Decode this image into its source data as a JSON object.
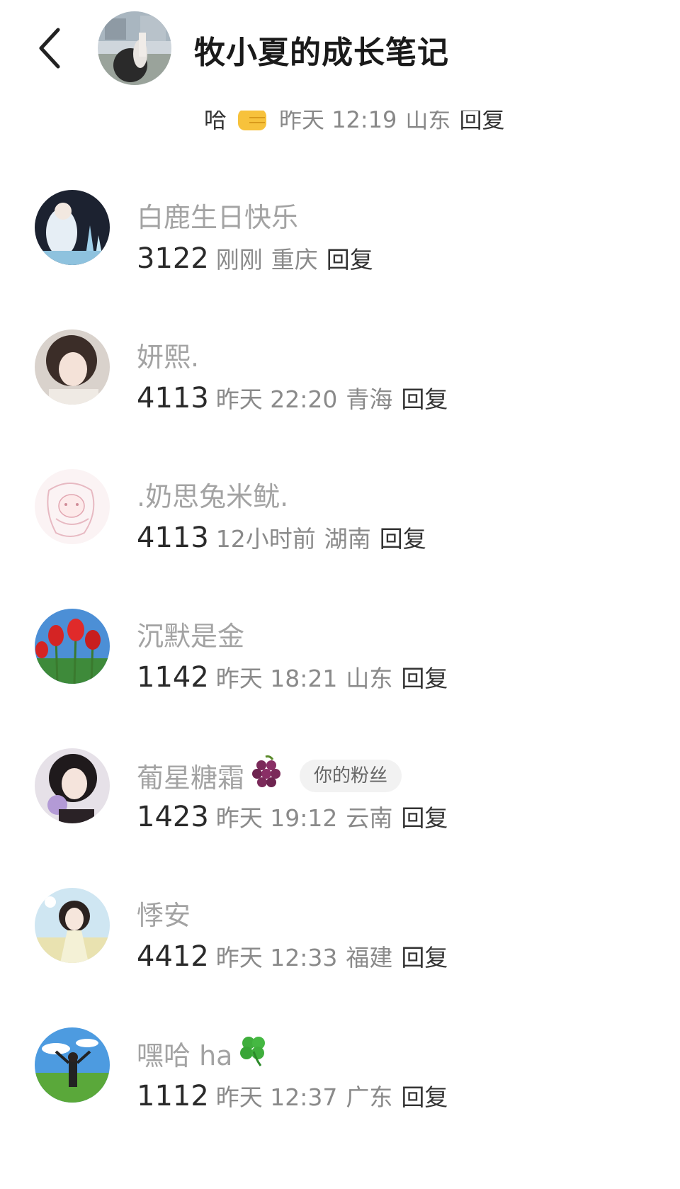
{
  "header": {
    "title": "牧小夏的成长笔记"
  },
  "partial_comment": {
    "text": "哈",
    "time": "昨天 12:19",
    "region": "山东",
    "reply_label": "回复"
  },
  "colors": {
    "name_gray": "#a3a3a3",
    "meta_gray": "#8a8a8a",
    "badge_bg": "#f2f2f2"
  },
  "comments": [
    {
      "name": "白鹿生日快乐",
      "number": "3122",
      "time": "刚刚",
      "region": "重庆",
      "reply_label": "回复",
      "emoji": "",
      "badge": ""
    },
    {
      "name": "妍熙.",
      "number": "4113",
      "time": "昨天 22:20",
      "region": "青海",
      "reply_label": "回复",
      "emoji": "",
      "badge": ""
    },
    {
      "name": ".奶思兔米鱿.",
      "number": "4113",
      "time": "12小时前",
      "region": "湖南",
      "reply_label": "回复",
      "emoji": "",
      "badge": ""
    },
    {
      "name": "沉默是金",
      "number": "1142",
      "time": "昨天 18:21",
      "region": "山东",
      "reply_label": "回复",
      "emoji": "",
      "badge": ""
    },
    {
      "name": "葡星糖霜",
      "number": "1423",
      "time": "昨天 19:12",
      "region": "云南",
      "reply_label": "回复",
      "emoji": "grape-icon",
      "badge": "你的粉丝"
    },
    {
      "name": "悸安",
      "number": "4412",
      "time": "昨天 12:33",
      "region": "福建",
      "reply_label": "回复",
      "emoji": "",
      "badge": ""
    },
    {
      "name": "嘿哈 ha",
      "number": "1112",
      "time": "昨天 12:37",
      "region": "广东",
      "reply_label": "回复",
      "emoji": "clover-icon",
      "badge": ""
    }
  ]
}
